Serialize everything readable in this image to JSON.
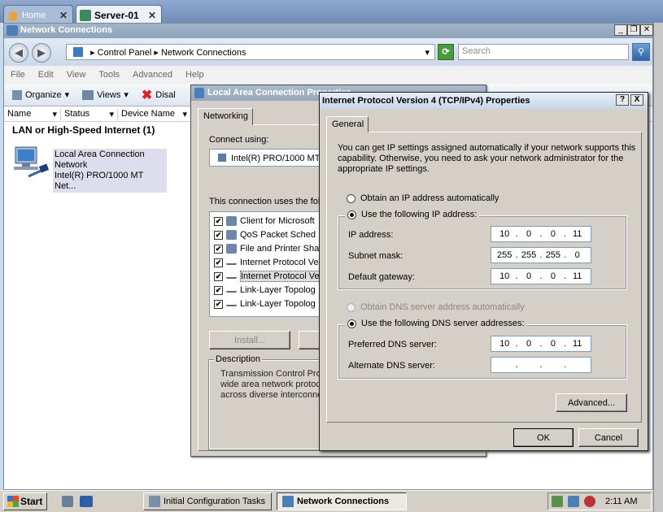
{
  "vm_tabs": [
    {
      "label": "Home"
    },
    {
      "label": "Server-01"
    }
  ],
  "explorer": {
    "title": "Network Connections",
    "breadcrumb": [
      "Control Panel",
      "Network Connections"
    ],
    "search_placeholder": "Search",
    "menu": [
      "File",
      "Edit",
      "View",
      "Tools",
      "Advanced",
      "Help"
    ],
    "toolbar": {
      "organize": "Organize",
      "views": "Views",
      "disable": "Disal"
    },
    "columns": [
      "Name",
      "Status",
      "Device Name"
    ],
    "group_header": "LAN or High-Speed Internet (1)",
    "connection": {
      "name": "Local Area Connection",
      "type": "Network",
      "adapter": "Intel(R) PRO/1000 MT Net..."
    }
  },
  "lac_dialog": {
    "title": "Local Area Connection Properties",
    "tab": "Networking",
    "connect_using_label": "Connect using:",
    "adapter": "Intel(R) PRO/1000 MT",
    "uses_label": "This connection uses the foll",
    "components": [
      {
        "label": "Client for Microsoft",
        "checked": true
      },
      {
        "label": "QoS Packet Sched",
        "checked": true
      },
      {
        "label": "File and Printer Sha",
        "checked": true
      },
      {
        "label": "Internet Protocol Ve",
        "checked": true
      },
      {
        "label": "Internet Protocol Ve",
        "checked": true,
        "selected": true
      },
      {
        "label": "Link-Layer Topolog",
        "checked": true
      },
      {
        "label": "Link-Layer Topolog",
        "checked": true
      }
    ],
    "install_label": "Install...",
    "description_label": "Description",
    "description": "Transmission Control Proto wide area network protoc across diverse interconne"
  },
  "ipv4_dialog": {
    "title": "Internet Protocol Version 4 (TCP/IPv4) Properties",
    "help_btn": "?",
    "close_btn": "X",
    "tab": "General",
    "intro": "You can get IP settings assigned automatically if your network supports this capability. Otherwise, you need to ask your network administrator for the appropriate IP settings.",
    "radio_auto_ip": "Obtain an IP address automatically",
    "radio_use_ip": "Use the following IP address:",
    "ip_label": "IP address:",
    "ip_value": [
      "10",
      "0",
      "0",
      "11"
    ],
    "mask_label": "Subnet mask:",
    "mask_value": [
      "255",
      "255",
      "255",
      "0"
    ],
    "gateway_label": "Default gateway:",
    "gateway_value": [
      "10",
      "0",
      "0",
      "11"
    ],
    "radio_auto_dns": "Obtain DNS server address automatically",
    "radio_use_dns": "Use the following DNS server addresses:",
    "pref_dns_label": "Preferred DNS server:",
    "pref_dns_value": [
      "10",
      "0",
      "0",
      "11"
    ],
    "alt_dns_label": "Alternate DNS server:",
    "alt_dns_value": [
      "",
      "",
      "",
      ""
    ],
    "advanced_label": "Advanced...",
    "ok_label": "OK",
    "cancel_label": "Cancel"
  },
  "taskbar": {
    "start_label": "Start",
    "tasks": [
      "Initial Configuration Tasks",
      "Network Connections"
    ],
    "clock": "2:11 AM"
  },
  "colors": {
    "title_active": "#c8d6ea",
    "dialog_bg": "#d4d0c8",
    "taskbar": "#d4d0c8"
  }
}
